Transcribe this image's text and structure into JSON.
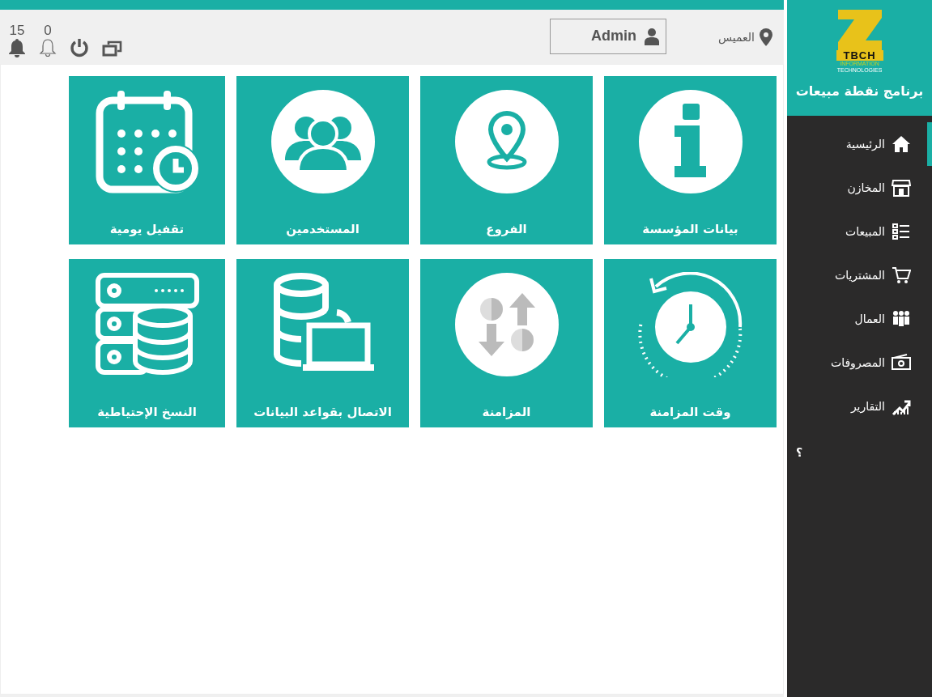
{
  "header": {
    "location": "العميس",
    "user": "Admin",
    "notifications": [
      {
        "count": "0",
        "kind": "outline"
      },
      {
        "count": "15",
        "kind": "filled"
      }
    ]
  },
  "sidebar": {
    "logo": {
      "mark": "TBCH",
      "line_1": "INFORMATION",
      "line_2": "TECHNOLOGIES"
    },
    "title": "برنامج نقطة مبيعات",
    "items": [
      {
        "label": "الرئيسية",
        "selected": true
      },
      {
        "label": "المخازن",
        "selected": false
      },
      {
        "label": "المبيعات",
        "selected": false
      },
      {
        "label": "المشتريات",
        "selected": false
      },
      {
        "label": "العمال",
        "selected": false
      },
      {
        "label": "المصروفات",
        "selected": false
      },
      {
        "label": "التقارير",
        "selected": false
      }
    ],
    "help": "؟"
  },
  "tiles": [
    {
      "label": "بيانات المؤسسة"
    },
    {
      "label": "الفروع"
    },
    {
      "label": "المستخدمين"
    },
    {
      "label": "تقفيل يومية"
    },
    {
      "label": "وقت المزامنة"
    },
    {
      "label": "المزامنة"
    },
    {
      "label": "الاتصال بقواعد البيانات"
    },
    {
      "label": "النسخ الإحتياطية"
    }
  ]
}
